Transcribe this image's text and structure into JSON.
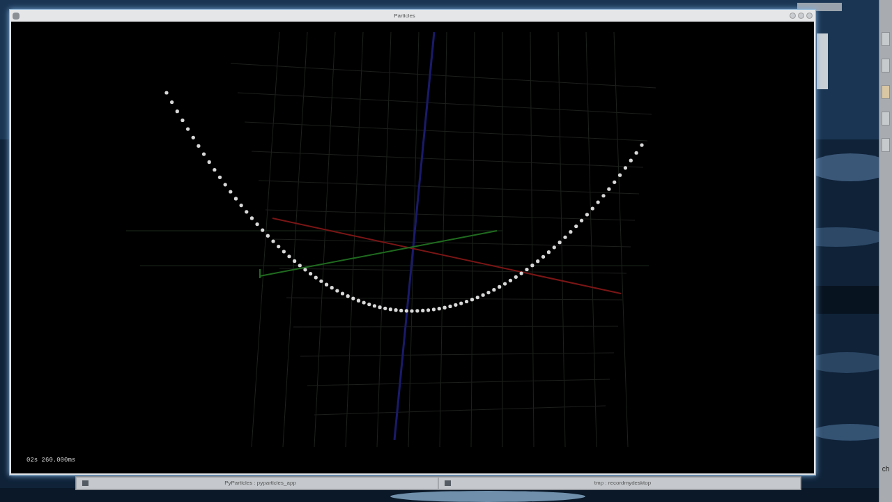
{
  "window": {
    "title": "Particles"
  },
  "viewport": {
    "timer": "02s 260.000ms"
  },
  "taskbar": {
    "items": [
      {
        "label": "PyParticles : pyparticles_app",
        "selected": false
      },
      {
        "label": "tmp : recordmydesktop",
        "selected": false
      }
    ]
  },
  "side_panel": {
    "label": "ch"
  }
}
